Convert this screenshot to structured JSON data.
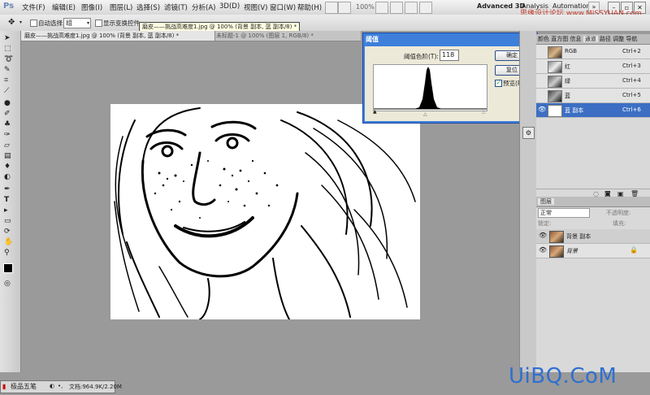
{
  "app": {
    "logo": "Ps"
  },
  "menu": [
    "文件(F)",
    "编辑(E)",
    "图像(I)",
    "图层(L)",
    "选择(S)",
    "滤镜(T)",
    "分析(A)",
    "3D(D)",
    "视图(V)",
    "窗口(W)",
    "帮助(H)"
  ],
  "zoom": "100%",
  "workspaces": [
    "Advanced 3D",
    "Analysis",
    "Automation"
  ],
  "site_badge": "思缘设计论坛  www.MISSYUAN.com",
  "options": {
    "auto_select": "自动选择:",
    "group_value": "组",
    "show_transform": "显示变换控件"
  },
  "tooltip": "磨皮——挑战高难度1.jpg @ 100% (背景 副本, 蓝 副本/8) *",
  "doc_tabs": [
    {
      "label": "磨皮——挑战高难度1.jpg @ 100% (背景 副本, 蓝 副本/8) *",
      "active": true
    },
    {
      "label": "未标题-1 @ 100% (图层 1, RGB/8) *",
      "active": false
    }
  ],
  "channels_panel": {
    "tabs": [
      "颜色",
      "直方图",
      "信息",
      "通道",
      "路径",
      "调整",
      "导航"
    ],
    "rows": [
      {
        "name": "RGB",
        "shortcut": "Ctrl+2",
        "selected": false
      },
      {
        "name": "红",
        "shortcut": "Ctrl+3",
        "selected": false
      },
      {
        "name": "绿",
        "shortcut": "Ctrl+4",
        "selected": false
      },
      {
        "name": "蓝",
        "shortcut": "Ctrl+5",
        "selected": false
      },
      {
        "name": "蓝 副本",
        "shortcut": "Ctrl+6",
        "selected": true
      }
    ]
  },
  "layers_panel": {
    "tab": "图层",
    "blend_mode": "正常",
    "opacity_label": "不透明度:",
    "fill_label": "填充:",
    "lock_label": "锁定:",
    "rows": [
      {
        "name": "背景 副本",
        "selected": true
      },
      {
        "name": "背景",
        "selected": false
      }
    ]
  },
  "dialog": {
    "title": "阈值",
    "level_label": "阈值色阶(T):",
    "level_value": "118",
    "ok": "确定",
    "reset": "复位",
    "preview": "预览(P)",
    "preview_checked": true
  },
  "status": {
    "ime": "极品五笔",
    "doc_size": "文档:964.9K/2.20M"
  },
  "watermark": "UiBQ.CoM",
  "colors": {
    "accent_selected": "#3c6fc4",
    "dialog_title": "#3d7fdb",
    "watermark": "#2f6fd1"
  }
}
